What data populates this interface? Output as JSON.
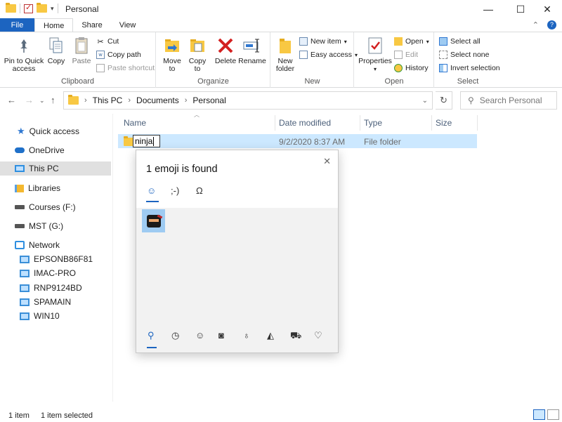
{
  "window": {
    "title": "Personal"
  },
  "ribbon_tabs": [
    "File",
    "Home",
    "Share",
    "View"
  ],
  "clipboard": {
    "pin": "Pin to Quick access",
    "copy": "Copy",
    "paste": "Paste",
    "cut": "Cut",
    "copy_path": "Copy path",
    "paste_shortcut": "Paste shortcut",
    "label": "Clipboard"
  },
  "organize": {
    "move_to": "Move to",
    "copy_to": "Copy to",
    "delete": "Delete",
    "rename": "Rename",
    "label": "Organize"
  },
  "new": {
    "new_folder": "New folder",
    "new_item": "New item",
    "easy_access": "Easy access",
    "label": "New"
  },
  "open": {
    "properties": "Properties",
    "open": "Open",
    "edit": "Edit",
    "history": "History",
    "label": "Open"
  },
  "select": {
    "select_all": "Select all",
    "select_none": "Select none",
    "invert": "Invert selection",
    "label": "Select"
  },
  "address": {
    "crumbs": [
      "This PC",
      "Documents",
      "Personal"
    ],
    "search_placeholder": "Search Personal"
  },
  "nav": [
    {
      "label": "Quick access",
      "icon": "star-icon"
    },
    {
      "label": "OneDrive",
      "icon": "cloud-icon"
    },
    {
      "label": "This PC",
      "icon": "computer-icon",
      "selected": true
    },
    {
      "label": "Libraries",
      "icon": "libraries-icon"
    },
    {
      "label": "Courses (F:)",
      "icon": "drive-icon"
    },
    {
      "label": "MST (G:)",
      "icon": "drive-icon"
    },
    {
      "label": "Network",
      "icon": "network-icon"
    },
    {
      "label": "EPSONB86F81",
      "icon": "monitor-icon"
    },
    {
      "label": "IMAC-PRO",
      "icon": "monitor-icon"
    },
    {
      "label": "RNP9124BD",
      "icon": "monitor-icon"
    },
    {
      "label": "SPAMAIN",
      "icon": "monitor-icon"
    },
    {
      "label": "WIN10",
      "icon": "monitor-icon"
    }
  ],
  "columns": [
    "Name",
    "Date modified",
    "Type",
    "Size"
  ],
  "files": [
    {
      "name": "ninja",
      "date": "9/2/2020 8:37 AM",
      "type": "File folder",
      "size": ""
    }
  ],
  "emoji_panel": {
    "title": "1 emoji is found",
    "tabs": [
      "☺",
      ";-)",
      "Ω"
    ],
    "results": [
      "ninja-cat"
    ],
    "categories": [
      "search",
      "recent",
      "smiley",
      "people",
      "celebration",
      "food",
      "travel",
      "heart"
    ]
  },
  "status": {
    "count": "1 item",
    "selected": "1 item selected"
  }
}
